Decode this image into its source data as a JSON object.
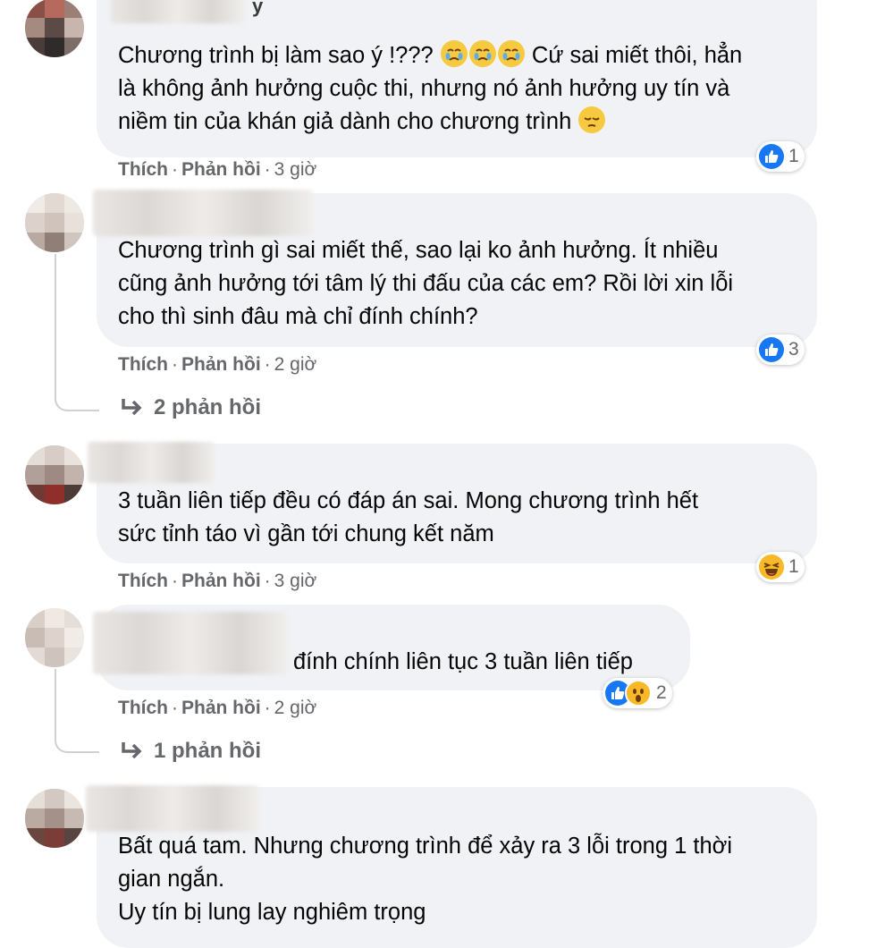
{
  "actions": {
    "like": "Thích",
    "reply": "Phản hồi",
    "sep": "·"
  },
  "comments": [
    {
      "name_visible": "y",
      "text_before": "Chương trình bị làm sao ý !???",
      "text_after": " Cứ sai miết thôi, hẳn\nlà không ảnh hưởng cuộc thi, nhưng nó ảnh hưởng uy tín và\nniềm tin của khán giả dành cho chương trình",
      "time": "3 giờ",
      "reaction_count": "1"
    },
    {
      "text": "Chương trình gì sai miết thế, sao lại ko ảnh hưởng. Ít nhiều\ncũng ảnh hưởng tới tâm lý thi đấu của các em? Rồi lời xin lỗi\ncho thì sinh đâu mà chỉ đính chính?",
      "time": "2 giờ",
      "reaction_count": "3",
      "replies_label": "2 phản hồi"
    },
    {
      "text": "3 tuần liên tiếp đều có đáp án sai. Mong chương trình hết\nsức tỉnh táo vì gần tới chung kết năm",
      "time": "3 giờ",
      "reaction_count": "1"
    },
    {
      "text": "đính chính liên tục 3 tuần liên tiếp",
      "time": "2 giờ",
      "reaction_count": "2",
      "replies_label": "1 phản hồi"
    },
    {
      "text": "Bất quá tam. Nhưng chương trình để xảy ra 3 lỗi trong 1 thời\ngian ngắn.\nUy tín bị lung lay nghiêm trọng"
    }
  ],
  "colors": {
    "bubble": "#f0f2f5",
    "meta": "#65676b",
    "like": "#1877f2",
    "haha": "#f7b928"
  },
  "icons": [
    "like-icon",
    "haha-icon",
    "wow-icon",
    "reply-arrow-icon",
    "crying-emoji",
    "pensive-emoji"
  ]
}
